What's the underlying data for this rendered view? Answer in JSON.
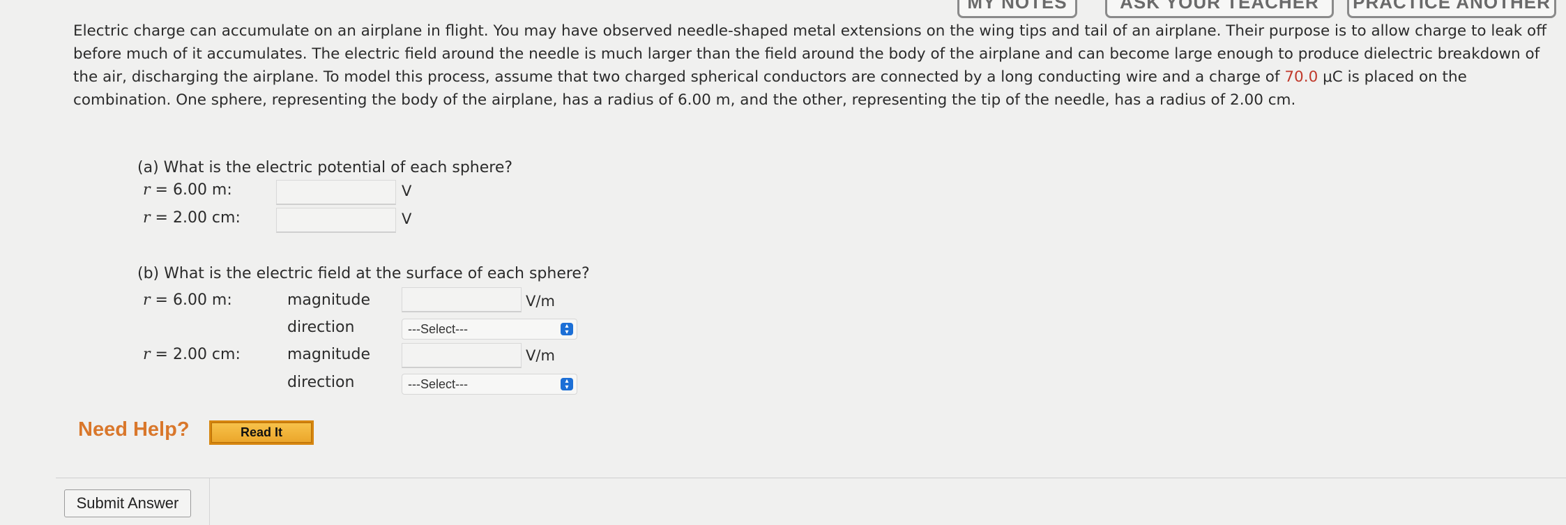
{
  "top_buttons": {
    "notes": "MY NOTES",
    "ask": "ASK YOUR TEACHER",
    "practice": "PRACTICE ANOTHER"
  },
  "problem": {
    "text_before": "Electric charge can accumulate on an airplane in flight. You may have observed needle-shaped metal extensions on the wing tips and tail of an airplane. Their purpose is to allow charge to leak off before much of it accumulates. The electric field around the needle is much larger than the field around the body of the airplane and can become large enough to produce dielectric breakdown of the air, discharging the airplane. To model this process, assume that two charged spherical conductors are connected by a long conducting wire and a charge of ",
    "charge_value": "70.0",
    "text_after": " μC is placed on the combination. One sphere, representing the body of the airplane, has a radius of 6.00 m, and the other, representing the tip of the needle, has a radius of 2.00 cm."
  },
  "part_a": {
    "question": "(a) What is the electric potential of each sphere?",
    "rows": [
      {
        "var": "r",
        "label": " = 6.00 m:",
        "unit": "V",
        "value": ""
      },
      {
        "var": "r",
        "label": " = 2.00 cm:",
        "unit": "V",
        "value": ""
      }
    ]
  },
  "part_b": {
    "question": "(b) What is the electric field at the surface of each sphere?",
    "rows": [
      {
        "var": "r",
        "label": " = 6.00 m:",
        "magnitude_label": "magnitude",
        "unit": "V/m",
        "direction_label": "direction",
        "select": "---Select---"
      },
      {
        "var": "r",
        "label": " = 2.00 cm:",
        "magnitude_label": "magnitude",
        "unit": "V/m",
        "direction_label": "direction",
        "select": "---Select---"
      }
    ]
  },
  "help": {
    "label": "Need Help?",
    "read_it": "Read It"
  },
  "submit_label": "Submit Answer",
  "colors": {
    "accent_red": "#c0392b",
    "help_orange": "#d9772b",
    "select_blue": "#1c6fd6"
  }
}
